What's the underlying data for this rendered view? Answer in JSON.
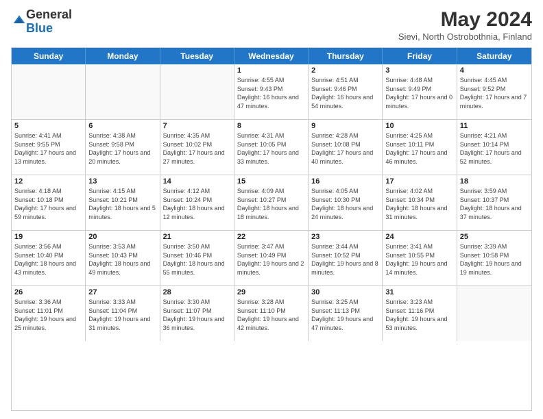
{
  "logo": {
    "general": "General",
    "blue": "Blue"
  },
  "header": {
    "title": "May 2024",
    "subtitle": "Sievi, North Ostrobothnia, Finland"
  },
  "days_of_week": [
    "Sunday",
    "Monday",
    "Tuesday",
    "Wednesday",
    "Thursday",
    "Friday",
    "Saturday"
  ],
  "weeks": [
    [
      {
        "day": "",
        "info": ""
      },
      {
        "day": "",
        "info": ""
      },
      {
        "day": "",
        "info": ""
      },
      {
        "day": "1",
        "info": "Sunrise: 4:55 AM\nSunset: 9:43 PM\nDaylight: 16 hours and 47 minutes."
      },
      {
        "day": "2",
        "info": "Sunrise: 4:51 AM\nSunset: 9:46 PM\nDaylight: 16 hours and 54 minutes."
      },
      {
        "day": "3",
        "info": "Sunrise: 4:48 AM\nSunset: 9:49 PM\nDaylight: 17 hours and 0 minutes."
      },
      {
        "day": "4",
        "info": "Sunrise: 4:45 AM\nSunset: 9:52 PM\nDaylight: 17 hours and 7 minutes."
      }
    ],
    [
      {
        "day": "5",
        "info": "Sunrise: 4:41 AM\nSunset: 9:55 PM\nDaylight: 17 hours and 13 minutes."
      },
      {
        "day": "6",
        "info": "Sunrise: 4:38 AM\nSunset: 9:58 PM\nDaylight: 17 hours and 20 minutes."
      },
      {
        "day": "7",
        "info": "Sunrise: 4:35 AM\nSunset: 10:02 PM\nDaylight: 17 hours and 27 minutes."
      },
      {
        "day": "8",
        "info": "Sunrise: 4:31 AM\nSunset: 10:05 PM\nDaylight: 17 hours and 33 minutes."
      },
      {
        "day": "9",
        "info": "Sunrise: 4:28 AM\nSunset: 10:08 PM\nDaylight: 17 hours and 40 minutes."
      },
      {
        "day": "10",
        "info": "Sunrise: 4:25 AM\nSunset: 10:11 PM\nDaylight: 17 hours and 46 minutes."
      },
      {
        "day": "11",
        "info": "Sunrise: 4:21 AM\nSunset: 10:14 PM\nDaylight: 17 hours and 52 minutes."
      }
    ],
    [
      {
        "day": "12",
        "info": "Sunrise: 4:18 AM\nSunset: 10:18 PM\nDaylight: 17 hours and 59 minutes."
      },
      {
        "day": "13",
        "info": "Sunrise: 4:15 AM\nSunset: 10:21 PM\nDaylight: 18 hours and 5 minutes."
      },
      {
        "day": "14",
        "info": "Sunrise: 4:12 AM\nSunset: 10:24 PM\nDaylight: 18 hours and 12 minutes."
      },
      {
        "day": "15",
        "info": "Sunrise: 4:09 AM\nSunset: 10:27 PM\nDaylight: 18 hours and 18 minutes."
      },
      {
        "day": "16",
        "info": "Sunrise: 4:05 AM\nSunset: 10:30 PM\nDaylight: 18 hours and 24 minutes."
      },
      {
        "day": "17",
        "info": "Sunrise: 4:02 AM\nSunset: 10:34 PM\nDaylight: 18 hours and 31 minutes."
      },
      {
        "day": "18",
        "info": "Sunrise: 3:59 AM\nSunset: 10:37 PM\nDaylight: 18 hours and 37 minutes."
      }
    ],
    [
      {
        "day": "19",
        "info": "Sunrise: 3:56 AM\nSunset: 10:40 PM\nDaylight: 18 hours and 43 minutes."
      },
      {
        "day": "20",
        "info": "Sunrise: 3:53 AM\nSunset: 10:43 PM\nDaylight: 18 hours and 49 minutes."
      },
      {
        "day": "21",
        "info": "Sunrise: 3:50 AM\nSunset: 10:46 PM\nDaylight: 18 hours and 55 minutes."
      },
      {
        "day": "22",
        "info": "Sunrise: 3:47 AM\nSunset: 10:49 PM\nDaylight: 19 hours and 2 minutes."
      },
      {
        "day": "23",
        "info": "Sunrise: 3:44 AM\nSunset: 10:52 PM\nDaylight: 19 hours and 8 minutes."
      },
      {
        "day": "24",
        "info": "Sunrise: 3:41 AM\nSunset: 10:55 PM\nDaylight: 19 hours and 14 minutes."
      },
      {
        "day": "25",
        "info": "Sunrise: 3:39 AM\nSunset: 10:58 PM\nDaylight: 19 hours and 19 minutes."
      }
    ],
    [
      {
        "day": "26",
        "info": "Sunrise: 3:36 AM\nSunset: 11:01 PM\nDaylight: 19 hours and 25 minutes."
      },
      {
        "day": "27",
        "info": "Sunrise: 3:33 AM\nSunset: 11:04 PM\nDaylight: 19 hours and 31 minutes."
      },
      {
        "day": "28",
        "info": "Sunrise: 3:30 AM\nSunset: 11:07 PM\nDaylight: 19 hours and 36 minutes."
      },
      {
        "day": "29",
        "info": "Sunrise: 3:28 AM\nSunset: 11:10 PM\nDaylight: 19 hours and 42 minutes."
      },
      {
        "day": "30",
        "info": "Sunrise: 3:25 AM\nSunset: 11:13 PM\nDaylight: 19 hours and 47 minutes."
      },
      {
        "day": "31",
        "info": "Sunrise: 3:23 AM\nSunset: 11:16 PM\nDaylight: 19 hours and 53 minutes."
      },
      {
        "day": "",
        "info": ""
      }
    ]
  ]
}
